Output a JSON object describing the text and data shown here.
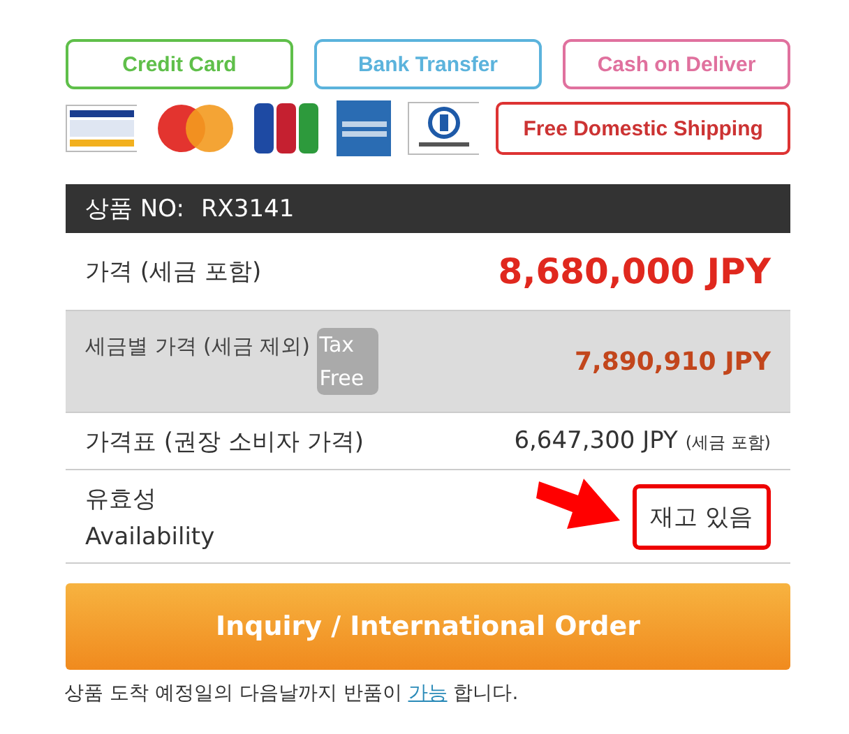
{
  "payment_badges": [
    {
      "label": "Credit Card",
      "color": "#5fbf4a"
    },
    {
      "label": "Bank Transfer",
      "color": "#5bb3dc"
    },
    {
      "label": "Cash on Deliver",
      "color": "#e0719e"
    }
  ],
  "card_logos": [
    {
      "kind": "stripes"
    },
    {
      "kind": "circles"
    },
    {
      "kind": "bars"
    },
    {
      "kind": "square"
    },
    {
      "kind": "ring"
    }
  ],
  "shipping_badge": "Free Domestic Shipping",
  "product": {
    "label": "상품 NO:",
    "code": "RX3141"
  },
  "rows": [
    {
      "kind": "price",
      "label": "가격 (세금 포함)",
      "value": "8,680,000 JPY"
    },
    {
      "kind": "taxfree",
      "label": "세금별 가격 (세금 제외)",
      "badge": "Tax Free",
      "value": "7,890,910 JPY"
    },
    {
      "kind": "list",
      "label": "가격표 (권장 소비자 가격)",
      "value": "6,647,300 JPY",
      "note": "(세금 포함)"
    },
    {
      "kind": "availability",
      "label": "유효성",
      "sublabel": "Availability",
      "value": "재고 있음"
    }
  ],
  "order_button": "Inquiry / International Order",
  "footer": {
    "before": "상품 도착 예정일의 다음날까지 반품이 ",
    "link": "가능",
    "after": " 합니다."
  }
}
